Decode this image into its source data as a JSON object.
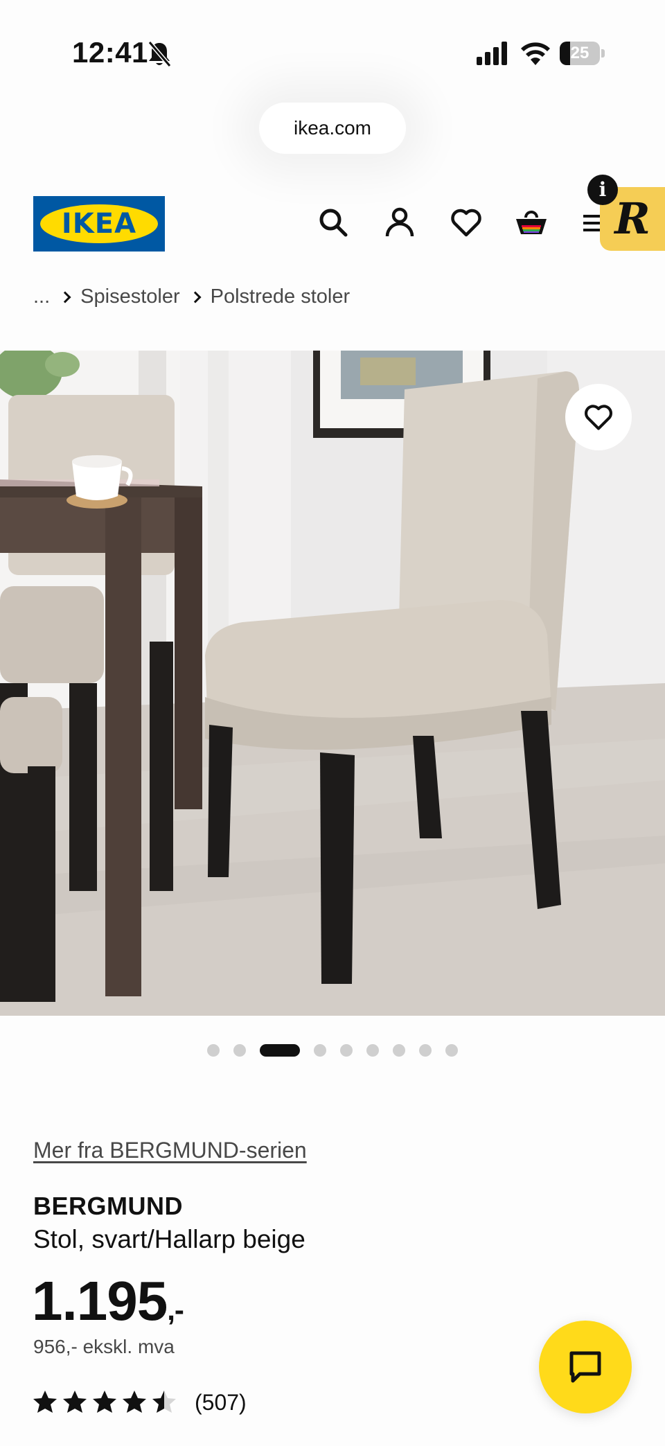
{
  "status_bar": {
    "time": "12:41",
    "battery_level": "25",
    "battery_fraction": 0.25
  },
  "browser": {
    "url": "ikea.com"
  },
  "header": {
    "logo_text": "IKEA",
    "icons": [
      "search-icon",
      "account-icon",
      "heart-icon",
      "cart-icon",
      "menu-icon"
    ],
    "extension_icon": "rakuten-icon",
    "extension_letter": "R",
    "info_badge": "i"
  },
  "breadcrumb": {
    "ellipsis": "...",
    "items": [
      "Spisestoler",
      "Polstrede stoler"
    ]
  },
  "gallery": {
    "image_count": 9,
    "active_index": 2
  },
  "product": {
    "series_link": "Mer fra BERGMUND-serien",
    "name": "BERGMUND",
    "description": "Stol, svart/Hallarp beige",
    "price_main": "1.195",
    "price_suffix": ",-",
    "price_excl_vat": "956,- ekskl. mva",
    "rating": 4.5,
    "rating_max": 5,
    "review_count": "(507)"
  },
  "colors": {
    "ikea_blue": "#0058a3",
    "ikea_yellow": "#ffdb00",
    "chat_yellow": "#ffda1a",
    "rakuten_yellow": "#f5cd55"
  }
}
